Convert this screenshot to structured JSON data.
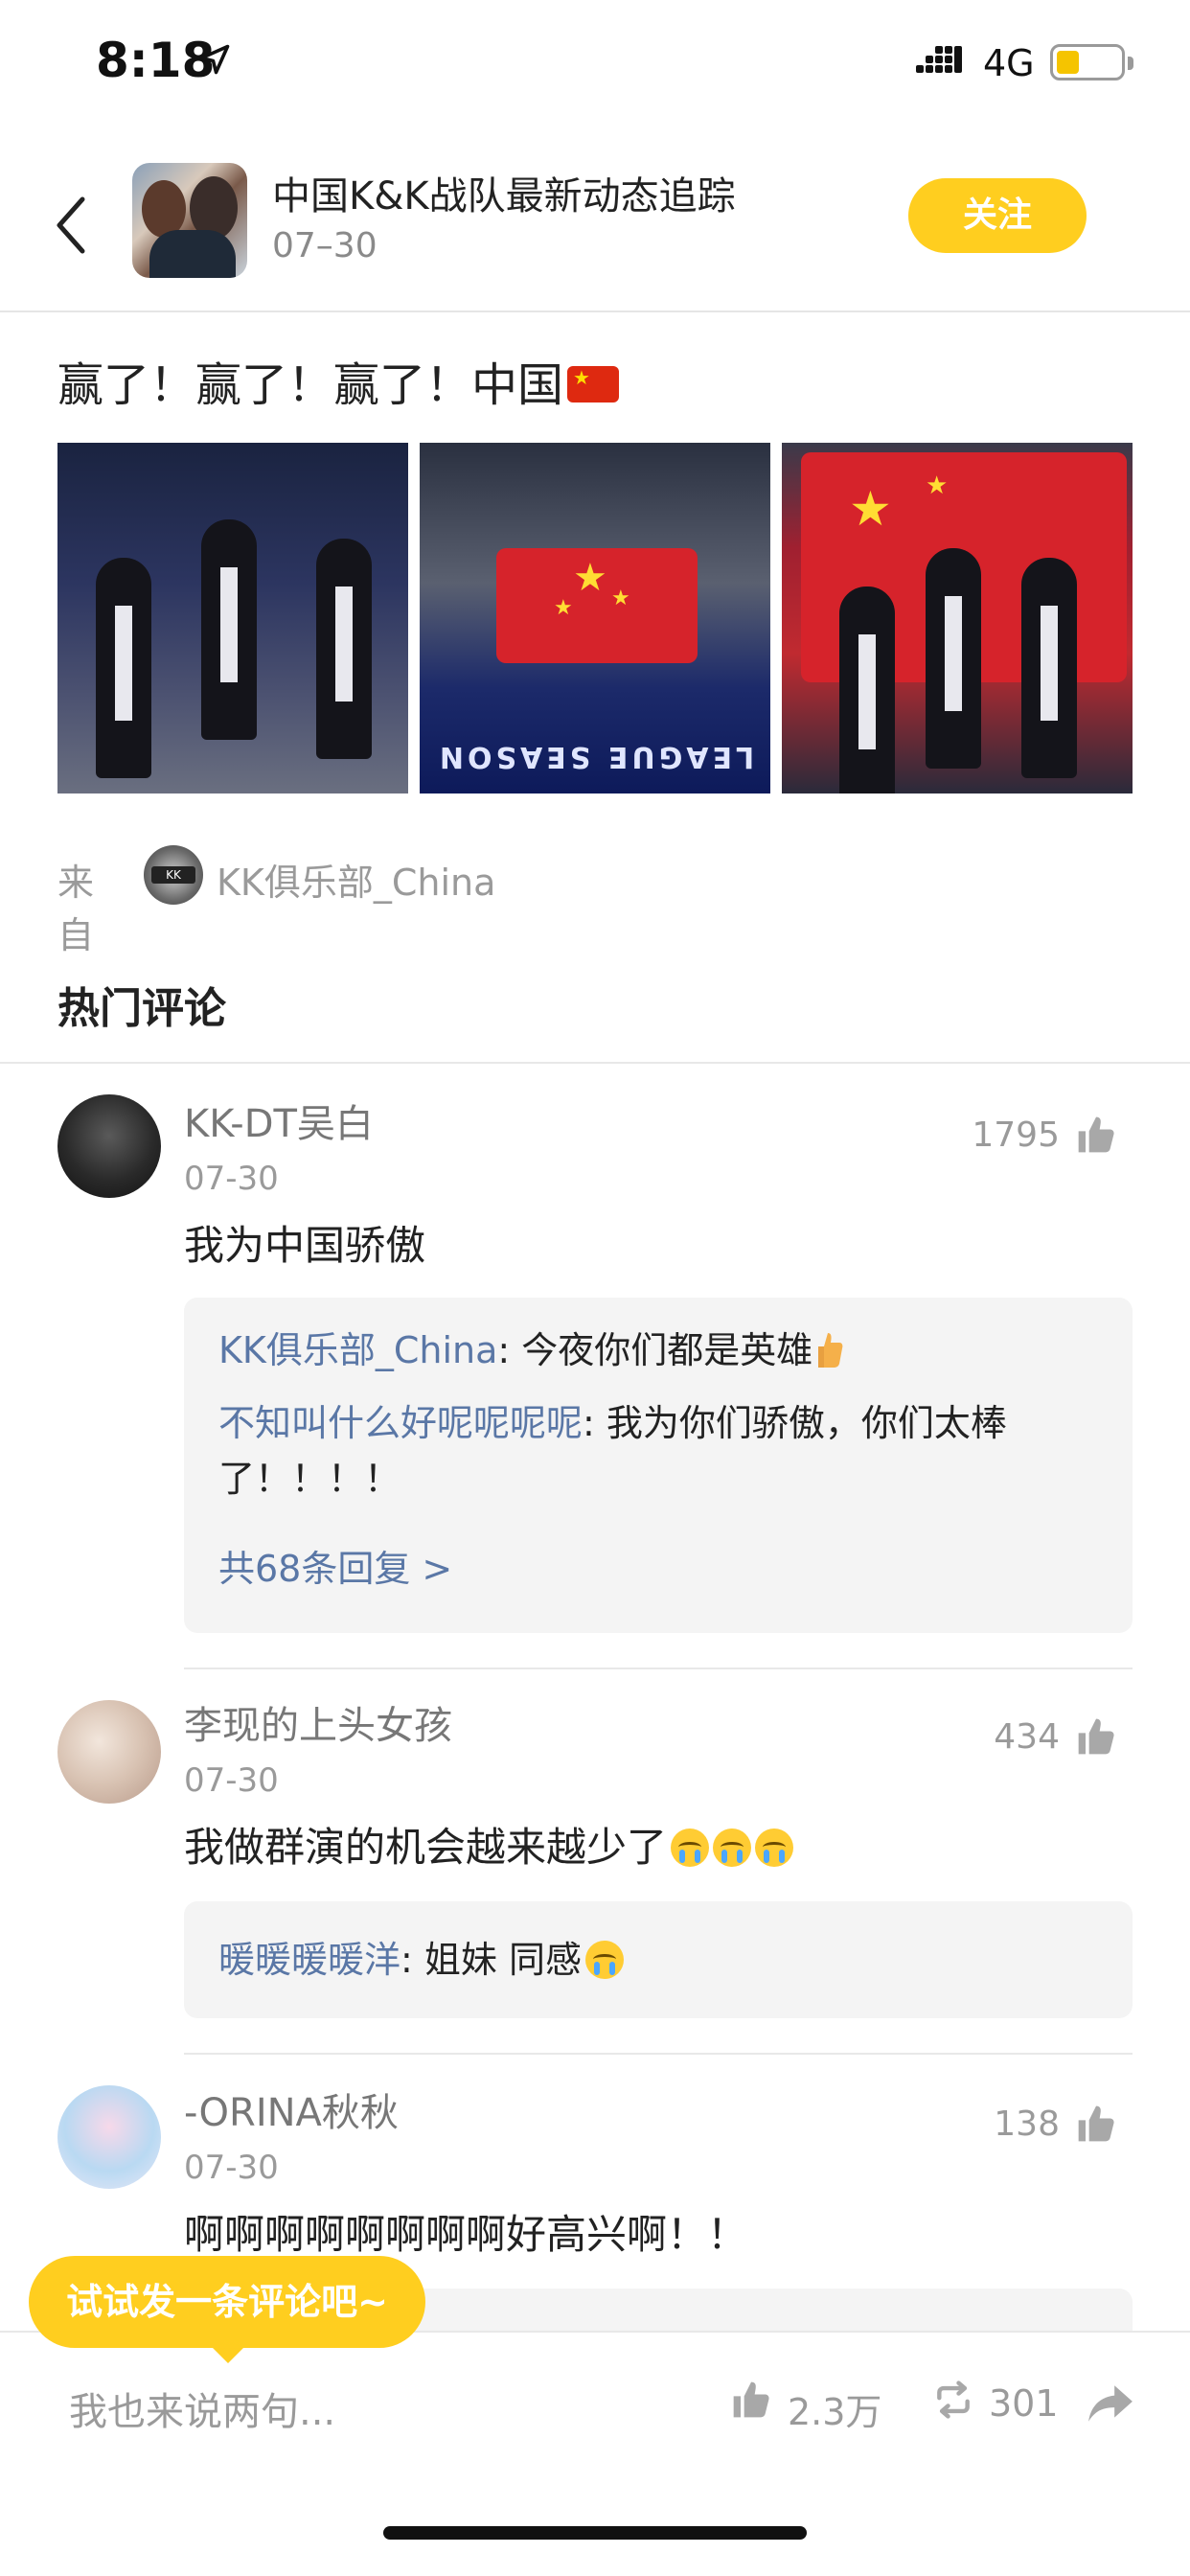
{
  "status": {
    "time": "8:18",
    "network": "4G",
    "battery_level": 0.35,
    "accent": "#f5c400"
  },
  "header": {
    "title": "中国K&K战队最新动态追踪",
    "date": "07–30",
    "follow_label": "关注",
    "follow_color": "#ffce1f"
  },
  "post": {
    "text": "赢了！赢了！赢了！中国",
    "photo_caption": "LEAGUE SEASON",
    "source_label": "来自",
    "source_name": "KK俱乐部_China"
  },
  "hot_comments_title": "热门评论",
  "comments": [
    {
      "name": "KK-DT吴白",
      "date": "07-30",
      "likes": "1795",
      "text": "我为中国骄傲",
      "replies": [
        {
          "name": "KK俱乐部_China",
          "text": ": 今夜你们都是英雄"
        },
        {
          "name": "不知叫什么好呢呢呢呢",
          "text": ": 我为你们骄傲，你们太棒了！！！！"
        }
      ],
      "more": "共68条回复 >"
    },
    {
      "name": "李现的上头女孩",
      "date": "07-30",
      "likes": "434",
      "text": "我做群演的机会越来越少了",
      "replies": [
        {
          "name": "暖暖暖暖洋",
          "text": ": 姐妹 同感"
        }
      ]
    },
    {
      "name": "-ORINA秋秋",
      "date": "07-30",
      "likes": "138",
      "text": "啊啊啊啊啊啊啊啊好高兴啊！！"
    }
  ],
  "bottom_bar": {
    "input_placeholder": "我也来说两句...",
    "likes": "2.3万",
    "reposts": "301"
  },
  "tooltip": "试试发一条评论吧~"
}
